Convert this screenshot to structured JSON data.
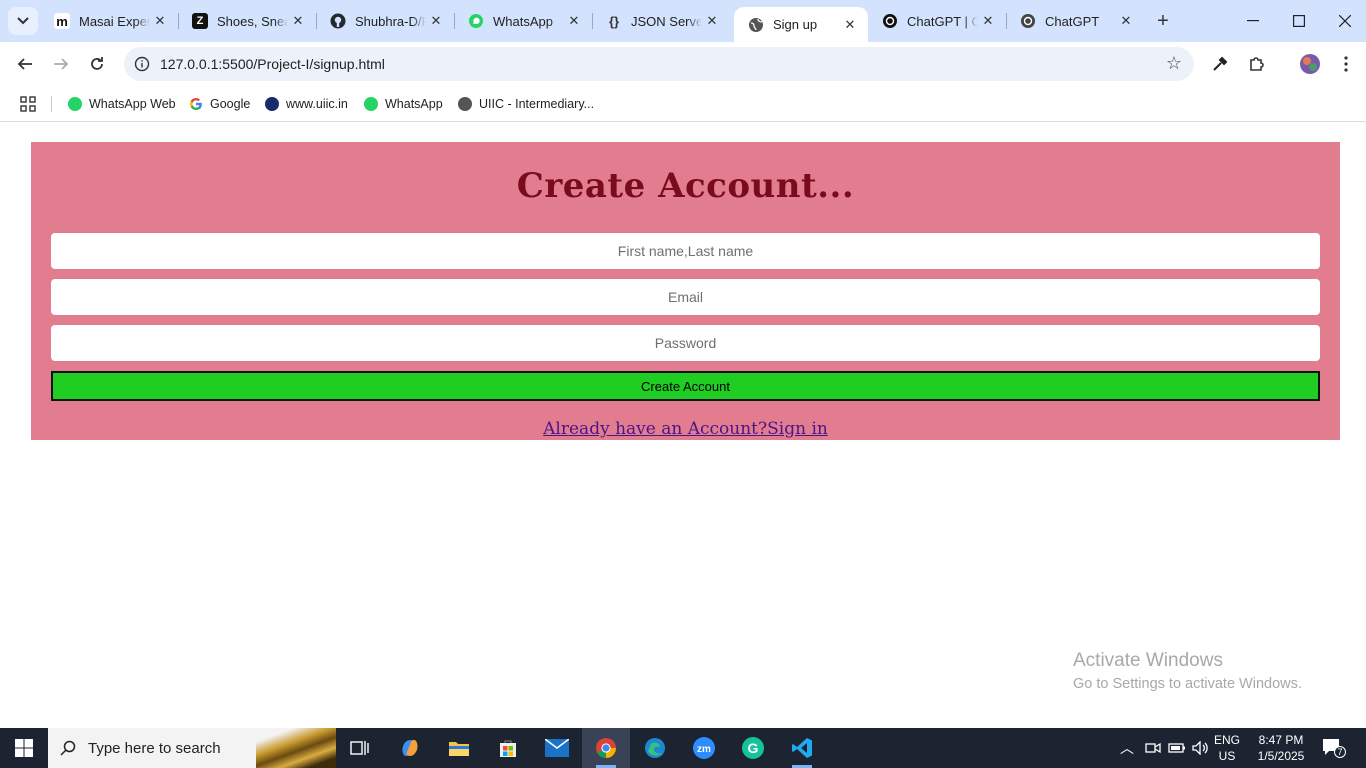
{
  "browser": {
    "tabs": [
      {
        "title": "Masai Experi",
        "icon": "masai-icon"
      },
      {
        "title": "Shoes, Sneak",
        "icon": "zappos-icon"
      },
      {
        "title": "Shubhra-D/P",
        "icon": "github-icon"
      },
      {
        "title": "WhatsApp",
        "icon": "whatsapp-icon"
      },
      {
        "title": "JSON Server",
        "icon": "json-server-icon"
      },
      {
        "title": "Sign up",
        "icon": "globe-icon",
        "active": true
      },
      {
        "title": "ChatGPT | O",
        "icon": "openai-icon"
      },
      {
        "title": "ChatGPT",
        "icon": "openai-icon"
      }
    ],
    "url": "127.0.0.1:5500/Project-I/signup.html",
    "bookmarks": [
      {
        "label": "WhatsApp Web",
        "icon": "whatsapp-icon"
      },
      {
        "label": "Google",
        "icon": "google-icon"
      },
      {
        "label": "www.uiic.in",
        "icon": "uiic-icon"
      },
      {
        "label": "WhatsApp",
        "icon": "whatsapp-icon"
      },
      {
        "label": "UIIC - Intermediary...",
        "icon": "globe-icon"
      }
    ]
  },
  "page": {
    "heading": "Create Account...",
    "name_placeholder": "First name,Last name",
    "email_placeholder": "Email",
    "password_placeholder": "Password",
    "submit_label": "Create Account",
    "signin_link": "Already have an Account?Sign in",
    "colors": {
      "card": "#e27d8f",
      "heading": "#7a0a1e",
      "button": "#1fcd23",
      "link": "#4b148a"
    }
  },
  "watermark": {
    "line1": "Activate Windows",
    "line2": "Go to Settings to activate Windows."
  },
  "taskbar": {
    "search_placeholder": "Type here to search",
    "lang_top": "ENG",
    "lang_bottom": "US",
    "time": "8:47 PM",
    "date": "1/5/2025",
    "notification_count": "7"
  }
}
